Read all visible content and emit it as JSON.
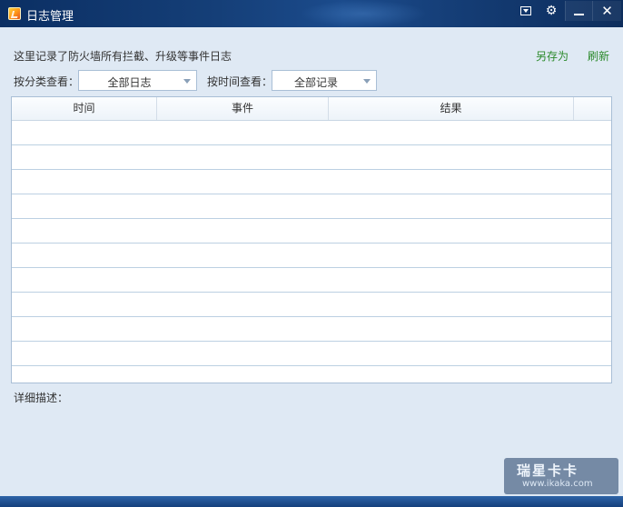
{
  "window": {
    "title": "日志管理",
    "menu_icon": "dropdown-menu-icon",
    "settings_icon": "gear-icon",
    "minimize_icon": "minimize-icon",
    "close_icon": "close-icon"
  },
  "header": {
    "description": "这里记录了防火墙所有拦截、升级等事件日志",
    "save_as": "另存为",
    "refresh": "刷新"
  },
  "filters": {
    "category_label": "按分类查看：",
    "category_value": "全部日志",
    "time_label": "按时间查看：",
    "time_value": "全部记录"
  },
  "table": {
    "columns": [
      "时间",
      "事件",
      "结果",
      ""
    ],
    "rows": []
  },
  "details": {
    "label": "详细描述："
  },
  "watermark": {
    "brand": "瑞星卡卡",
    "url": "www.ikaka.com"
  },
  "colors": {
    "titlebar": "#153f78",
    "body_bg": "#dfe9f4",
    "link_green": "#2c8a2c",
    "border": "#a9bfd6"
  }
}
